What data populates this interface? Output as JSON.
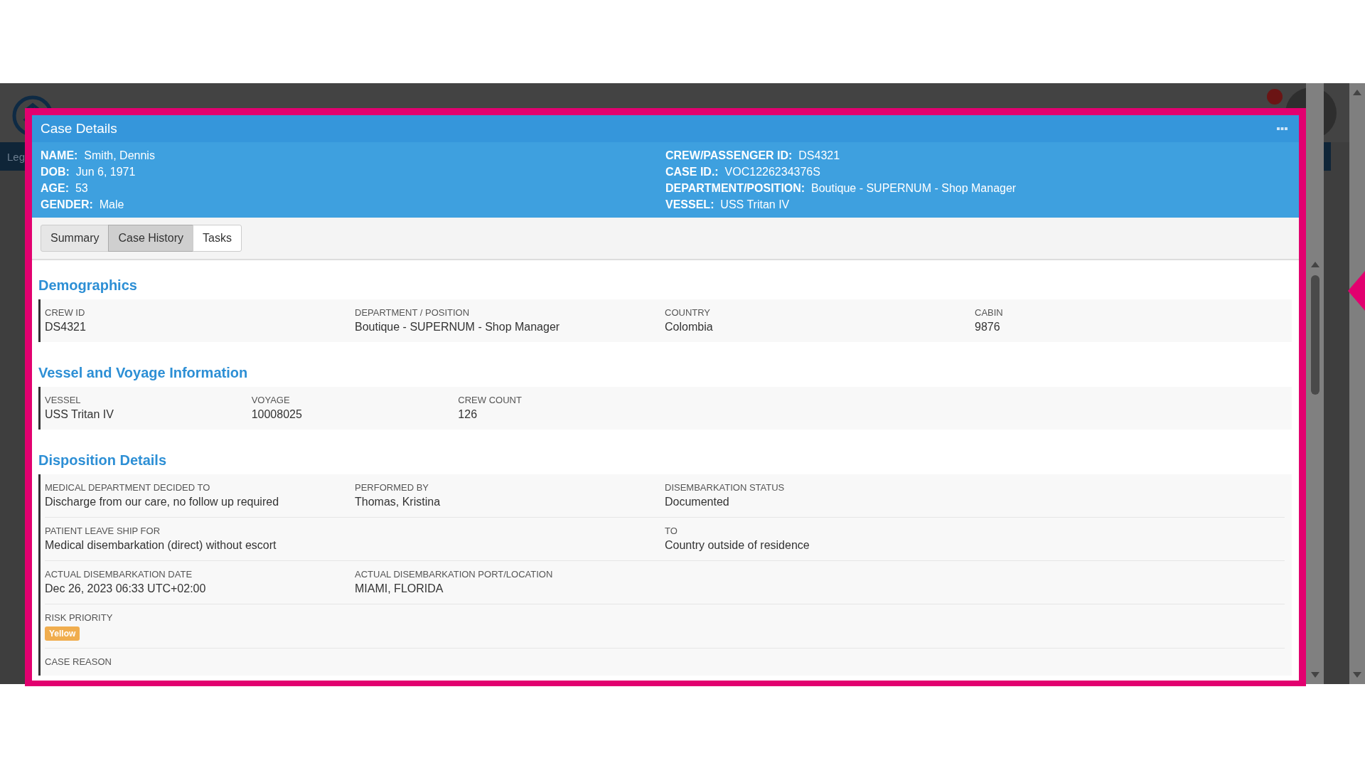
{
  "background": {
    "nav_text": "Leg"
  },
  "dialog": {
    "title": "Case Details",
    "summary_left": [
      {
        "label": "NAME:",
        "value": "Smith, Dennis"
      },
      {
        "label": "DOB:",
        "value": "Jun 6, 1971"
      },
      {
        "label": "AGE:",
        "value": "53"
      },
      {
        "label": "GENDER:",
        "value": "Male"
      }
    ],
    "summary_right": [
      {
        "label": "CREW/PASSENGER ID:",
        "value": "DS4321"
      },
      {
        "label": "CASE ID.:",
        "value": "VOC1226234376S"
      },
      {
        "label": "DEPARTMENT/POSITION:",
        "value": "Boutique - SUPERNUM - Shop Manager"
      },
      {
        "label": "VESSEL:",
        "value": "USS Tritan IV"
      }
    ],
    "tabs": [
      {
        "label": "Summary",
        "selected": false
      },
      {
        "label": "Case History",
        "selected": true
      },
      {
        "label": "Tasks",
        "selected": false
      }
    ],
    "sections": [
      {
        "title": "Demographics",
        "kind": "wide",
        "rows": [
          {
            "fields": [
              {
                "label": "CREW ID",
                "value": "DS4321"
              },
              {
                "label": "DEPARTMENT / POSITION",
                "value": "Boutique - SUPERNUM - Shop Manager"
              },
              {
                "label": "COUNTRY",
                "value": "Colombia"
              },
              {
                "label": "CABIN",
                "value": "9876"
              }
            ]
          }
        ]
      },
      {
        "title": "Vessel and Voyage Information",
        "kind": "compact",
        "rows": [
          {
            "fields": [
              {
                "label": "VESSEL",
                "value": "USS Tritan IV"
              },
              {
                "label": "VOYAGE",
                "value": "10008025"
              },
              {
                "label": "CREW COUNT",
                "value": "126"
              }
            ]
          }
        ]
      },
      {
        "title": "Disposition Details",
        "kind": "wide",
        "rows": [
          {
            "fields": [
              {
                "label": "MEDICAL DEPARTMENT DECIDED TO",
                "value": "Discharge from our care, no follow up required"
              },
              {
                "label": "PERFORMED BY",
                "value": "Thomas, Kristina"
              },
              {
                "label": "DISEMBARKATION STATUS",
                "value": "Documented"
              }
            ]
          },
          {
            "fields": [
              {
                "label": "PATIENT LEAVE SHIP FOR",
                "value": "Medical disembarkation (direct) without escort"
              }
            ],
            "right": [
              {
                "label": "TO",
                "value": "Country outside of residence"
              }
            ]
          },
          {
            "fields": [
              {
                "label": "ACTUAL DISEMBARKATION DATE",
                "value": "Dec 26, 2023 06:33 UTC+02:00"
              },
              {
                "label": "ACTUAL DISEMBARKATION PORT/LOCATION",
                "value": "MIAMI, FLORIDA"
              }
            ]
          },
          {
            "fields": [
              {
                "label": "RISK PRIORITY",
                "badge": "Yellow",
                "color": "#f0ad4e"
              }
            ]
          },
          {
            "fields": [
              {
                "label": "CASE REASON"
              }
            ]
          }
        ]
      }
    ]
  }
}
